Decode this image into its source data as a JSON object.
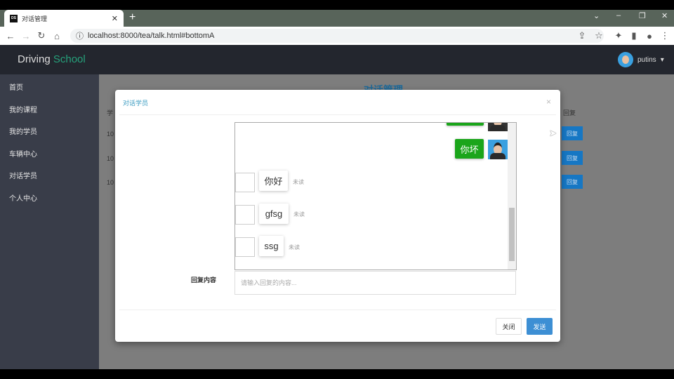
{
  "browser": {
    "tab_title": "对话管理",
    "favicon": "DS",
    "url": "localhost:8000/tea/talk.html#bottomA"
  },
  "navbar": {
    "brand_a": "Driving",
    "brand_b": "School",
    "user": "putins"
  },
  "sidebar": {
    "items": [
      "首页",
      "我的课程",
      "我的学员",
      "车辆中心",
      "对话学员",
      "个人中心"
    ]
  },
  "page": {
    "title": "对话管理",
    "col_first": "学",
    "col_last": "回复",
    "rows": [
      "10",
      "10",
      "10"
    ],
    "reply_label": "回复"
  },
  "modal": {
    "title": "对话学员",
    "close_x": "×",
    "messages": [
      {
        "side": "right",
        "text": "你坏"
      },
      {
        "side": "left",
        "text": "你好",
        "status": "未读"
      },
      {
        "side": "left",
        "text": "gfsg",
        "status": "未读"
      },
      {
        "side": "left",
        "text": "ssg",
        "status": "未读"
      }
    ],
    "reply_label": "回复内容",
    "reply_placeholder": "请输入回复的内容...",
    "close_button": "关闭",
    "send_button": "发送"
  },
  "colors": {
    "accent": "#26a17b",
    "send": "#3d8fd4",
    "bubble": "#1aa51a"
  }
}
